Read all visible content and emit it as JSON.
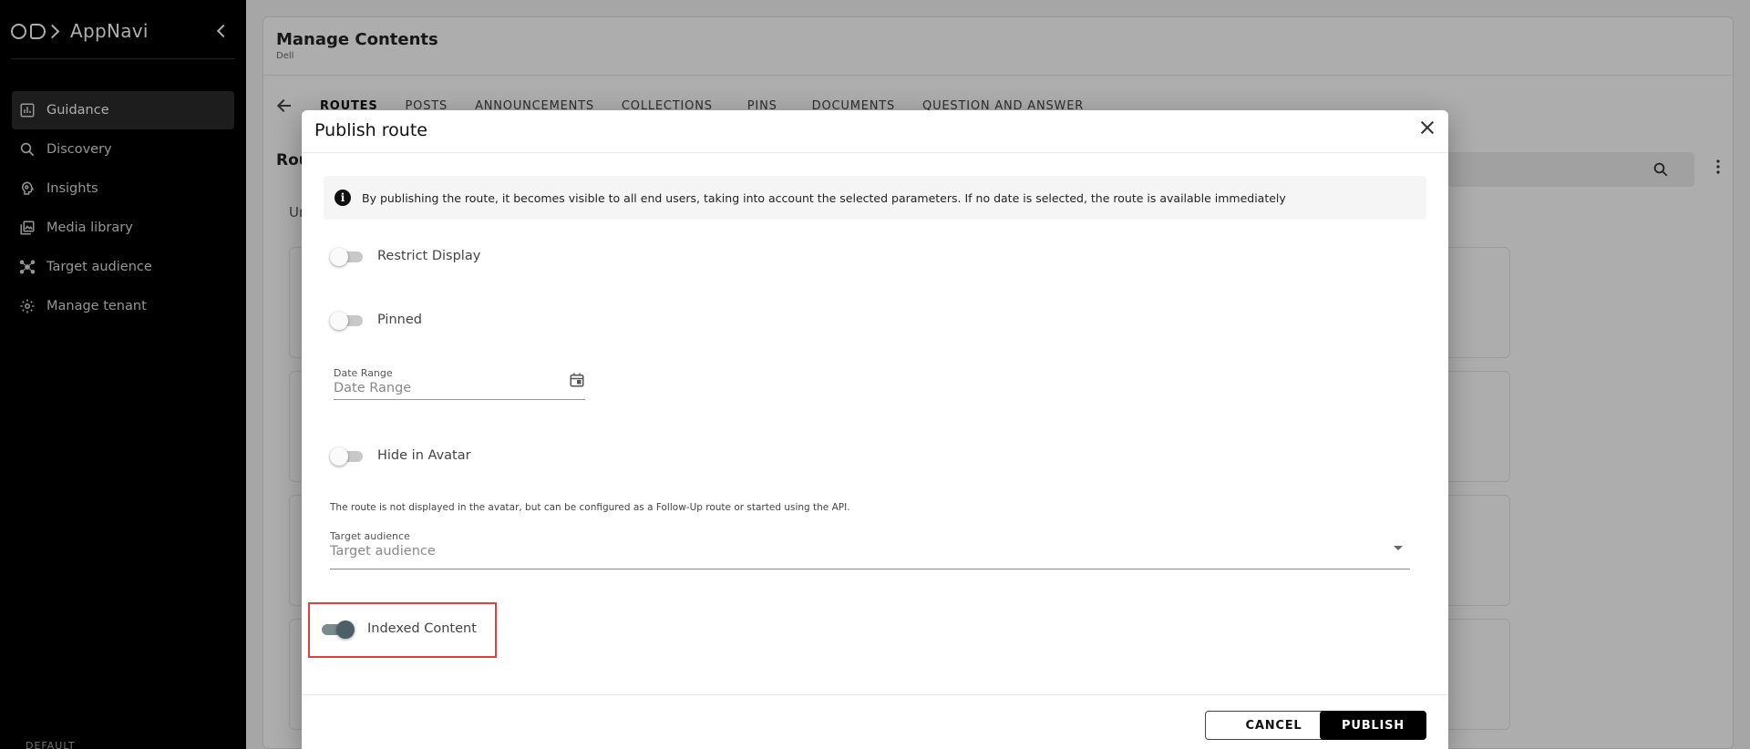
{
  "app": {
    "name": "AppNavi"
  },
  "sidebar": {
    "items": [
      {
        "label": "Guidance",
        "icon": "chart-icon",
        "active": true
      },
      {
        "label": "Discovery",
        "icon": "search-icon",
        "active": false
      },
      {
        "label": "Insights",
        "icon": "brain-icon",
        "active": false
      },
      {
        "label": "Media library",
        "icon": "media-icon",
        "active": false
      },
      {
        "label": "Target audience",
        "icon": "network-icon",
        "active": false
      },
      {
        "label": "Manage tenant",
        "icon": "gear-icon",
        "active": false
      }
    ],
    "footer": "DEFAULT"
  },
  "main": {
    "title": "Manage Contents",
    "subtitle": "Dell",
    "tabs": [
      {
        "label": "ROUTES",
        "active": true
      },
      {
        "label": "POSTS",
        "active": false
      },
      {
        "label": "ANNOUNCEMENTS",
        "active": false
      },
      {
        "label": "COLLECTIONS",
        "active": false
      },
      {
        "label": "PINS",
        "active": false
      },
      {
        "label": "DOCUMENTS",
        "active": false
      },
      {
        "label": "QUESTION AND ANSWER",
        "active": false
      }
    ],
    "section_title": "Rou",
    "section_sub": "Ur"
  },
  "dialog": {
    "title": "Publish route",
    "info_text": "By publishing the route, it becomes visible to all end users, taking into account the selected parameters. If no date is selected, the route is available immediately",
    "restrict_display_label": "Restrict Display",
    "pinned_label": "Pinned",
    "date_range_label": "Date Range",
    "date_range_placeholder": "Date Range",
    "hide_in_avatar_label": "Hide in Avatar",
    "hide_in_avatar_helper": "The route is not displayed in the avatar, but can be configured as a Follow-Up route or started using the API.",
    "target_audience_label": "Target audience",
    "target_audience_placeholder": "Target audience",
    "indexed_content_label": "Indexed Content",
    "toggles": {
      "restrict_display": false,
      "pinned": false,
      "hide_in_avatar": false,
      "indexed_content": true
    },
    "cancel_label": "CANCEL",
    "publish_label": "PUBLISH"
  },
  "colors": {
    "sidebar_bg": "#000000",
    "highlight": "#e04040",
    "toggle_on": "#4b5f65"
  }
}
